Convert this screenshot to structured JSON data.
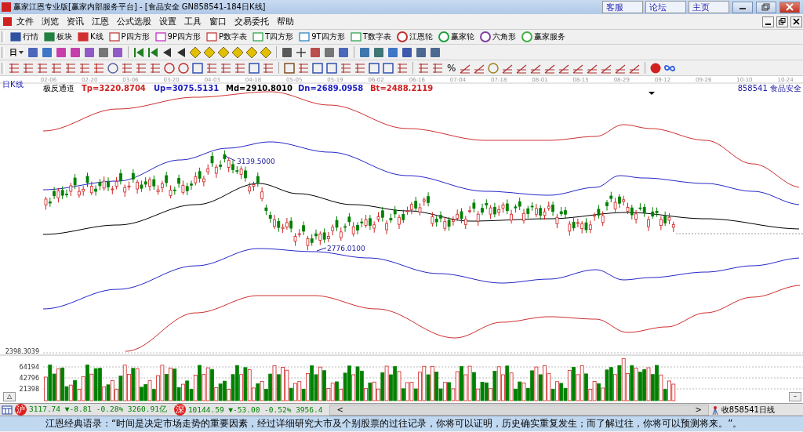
{
  "window": {
    "title": "赢家江恩专业版[赢家内部服务平台] - [食品安全  GN858541-184日K线]",
    "links": [
      "客服",
      "论坛",
      "主页"
    ]
  },
  "menu": [
    "文件",
    "浏览",
    "资讯",
    "江恩",
    "公式选股",
    "设置",
    "工具",
    "窗口",
    "交易委托",
    "帮助"
  ],
  "toolbar": [
    "行情",
    "板块",
    "K线",
    "P四方形",
    "9P四方形",
    "P数字表",
    "T四方形",
    "9T四方形",
    "T数字表",
    "江恩轮",
    "赢家轮",
    "六角形",
    "赢家服务"
  ],
  "period_button": "日",
  "percent_tool": "%",
  "chart": {
    "period_label": "日K线",
    "dates": [
      "02-06",
      "02-20",
      "03-06",
      "03-20",
      "04-03",
      "04-18",
      "05-05",
      "05-19",
      "06-02",
      "06-16",
      "07-04",
      "07-18",
      "08-01",
      "08-15",
      "08-29",
      "09-12",
      "09-26",
      "10-10",
      "10-24"
    ],
    "indicator": {
      "name": "极反通道",
      "values": [
        {
          "text": "Tp=3220.8704",
          "color": "#d02020"
        },
        {
          "text": "Up=3075.5131",
          "color": "#2020c0"
        },
        {
          "text": "Md=2910.8010",
          "color": "#000000"
        },
        {
          "text": "Dn=2689.0958",
          "color": "#2020c0"
        },
        {
          "text": "Bt=2488.2119",
          "color": "#d02020"
        }
      ]
    },
    "instrument": "858541  食品安全",
    "high_label": "3139.5000",
    "low_label": "2776.0100",
    "price_label": "2398.3039",
    "volume_ticks": [
      "64194",
      "42796",
      "21398"
    ],
    "collapse_button": "△",
    "expand_button": "–"
  },
  "status_bar": {
    "sh": {
      "badge": "沪",
      "text": "3117.74 ▼-8.81 -0.28% 3260.91亿"
    },
    "sz": {
      "badge": "深",
      "text": "10144.59 ▼-53.00 -0.52% 3956.4"
    },
    "scroll_left": "<",
    "scroll_right": ">",
    "right_text": "收858541日线"
  },
  "ticker": "江恩经典语录：“时间是决定市场走势的重要因素，经过详细研究大市及个别股票的过往记录，你将可以证明，历史确实重复发生；而了解过往，你将可以预测将来。”。"
}
